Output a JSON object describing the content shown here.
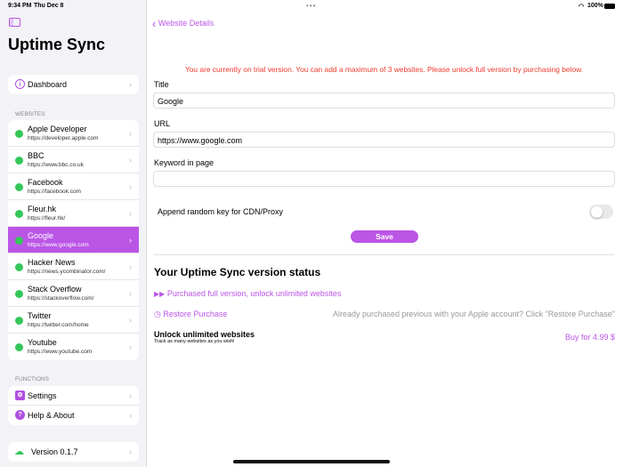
{
  "status_bar": {
    "time": "9:34 PM",
    "date": "Thu Dec 8",
    "battery": "100%"
  },
  "sidebar": {
    "title": "Uptime Sync",
    "dashboard": "Dashboard",
    "websites_header": "WEBSITES",
    "websites": [
      {
        "name": "Apple Developer",
        "url": "https://developer.apple.com"
      },
      {
        "name": "BBC",
        "url": "https://www.bbc.co.uk"
      },
      {
        "name": "Facebook",
        "url": "https://facebook.com"
      },
      {
        "name": "Fleur.hk",
        "url": "https://fleur.hk/"
      },
      {
        "name": "Google",
        "url": "https://www.google.com",
        "selected": true
      },
      {
        "name": "Hacker News",
        "url": "https://news.ycombinator.com/"
      },
      {
        "name": "Stack Overflow",
        "url": "https://stackoverflow.com/"
      },
      {
        "name": "Twitter",
        "url": "https://twitter.com/home"
      },
      {
        "name": "Youtube",
        "url": "https://www.youtube.com"
      }
    ],
    "functions_header": "FUNCTIONS",
    "settings": "Settings",
    "help": "Help & About",
    "version": "Version 0.1.7"
  },
  "main": {
    "back": "Website Details",
    "trial_notice": "You are currently on trial version. You can add a maximum of 3 websites. Please unlock full version by purchasing below.",
    "title_label": "Title",
    "title_value": "Google",
    "url_label": "URL",
    "url_value": "https://www.google.com",
    "keyword_label": "Keyword in page",
    "keyword_value": "",
    "append_label": "Append random key for CDN/Proxy",
    "append_on": false,
    "save": "Save",
    "status_heading": "Your Uptime Sync version status",
    "purchased": "Purchased full version, unlock unlimited websites",
    "restore": "Restore Purchase",
    "restore_hint": "Already purchased previous with your Apple account? Click \"Restore Purchase\"",
    "unlock_title": "Unlock unlimited websites",
    "unlock_sub": "Track as many websites as you wish!",
    "buy": "Buy for 4.99 $"
  }
}
